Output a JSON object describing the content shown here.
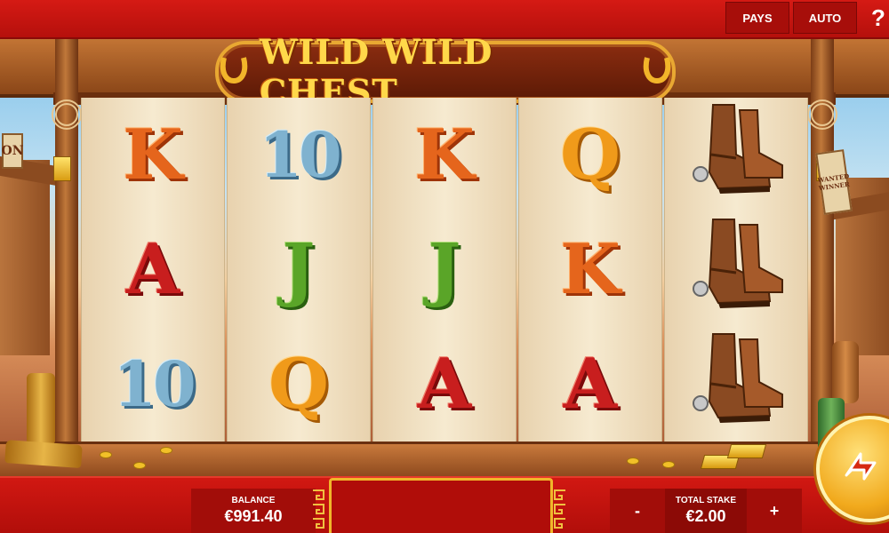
{
  "header": {
    "pays_label": "PAYS",
    "auto_label": "AUTO",
    "help_label": "?"
  },
  "game": {
    "title": "WILD WILD CHEST",
    "scenery": {
      "left_sign": "ON",
      "wanted_sign": "WANTED WINNER"
    }
  },
  "reels": [
    [
      "K",
      "A",
      "10"
    ],
    [
      "10",
      "J",
      "Q"
    ],
    [
      "K",
      "J",
      "A"
    ],
    [
      "Q",
      "K",
      "A"
    ],
    [
      "boots",
      "boots",
      "boots"
    ]
  ],
  "footer": {
    "balance_label": "BALANCE",
    "balance_value": "€991.40",
    "stake_label": "TOTAL STAKE",
    "stake_value": "€2.00",
    "minus_label": "-",
    "plus_label": "+"
  },
  "icons": {
    "spin": "spin-arrows-icon",
    "logo_ornament": "horseshoe-icon",
    "boots": "cowboy-boots-icon"
  },
  "colors": {
    "ui_red": "#c21010",
    "gold": "#f0b62a"
  }
}
